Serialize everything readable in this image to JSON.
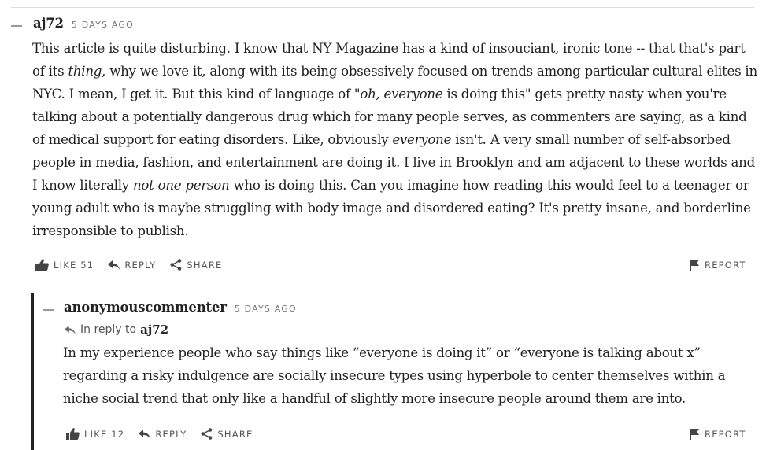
{
  "comment1": {
    "author": "aj72",
    "time": "5 DAYS AGO",
    "body_parts": {
      "p1": "This article is quite disturbing. I know that NY Magazine has a kind of insouciant, ironic tone -- that that's part of its ",
      "em1": "thing",
      "p2": ", why we love it, along with its being obsessively focused on trends among particular cultural elites in NYC. I mean, I get it. But this kind of language of \"",
      "em2": "oh, everyone",
      "p3": " is doing this\" gets pretty nasty when you're talking about a potentially dangerous drug which for many people serves, as commenters are saying, as a kind of medical support for eating disorders. Like, obviously ",
      "em3": "everyone",
      "p4": " isn't. A very small number of self-absorbed people in media, fashion, and entertainment are doing it. I live in Brooklyn and am adjacent to these worlds and I know literally ",
      "em4": "not one person",
      "p5": " who is doing this. Can you imagine how reading this would feel to a teenager or young adult who is maybe struggling with body image and disordered eating? It's pretty insane, and borderline irresponsible to publish."
    },
    "like_label": "LIKE",
    "like_count": "51",
    "reply_label": "REPLY",
    "share_label": "SHARE",
    "report_label": "REPORT"
  },
  "comment2": {
    "author": "anonymouscommenter",
    "time": "5 DAYS AGO",
    "in_reply_to_label": "In reply to",
    "in_reply_to_user": "aj72",
    "body": "In my experience people who say things like “everyone is doing it” or “everyone is talking about x” regarding a risky indulgence are socially insecure types using hyperbole to center themselves within a niche social trend that only like a handful of slightly more insecure people around them are into.",
    "like_label": "LIKE",
    "like_count": "12",
    "reply_label": "REPLY",
    "share_label": "SHARE",
    "report_label": "REPORT"
  },
  "icons": [
    "thumbs-up-icon",
    "reply-arrow-icon",
    "share-icon",
    "flag-icon",
    "collapse-icon"
  ],
  "colors": {
    "text": "#222222",
    "muted": "#555555",
    "meta": "#777777",
    "thread_line": "#222222"
  }
}
